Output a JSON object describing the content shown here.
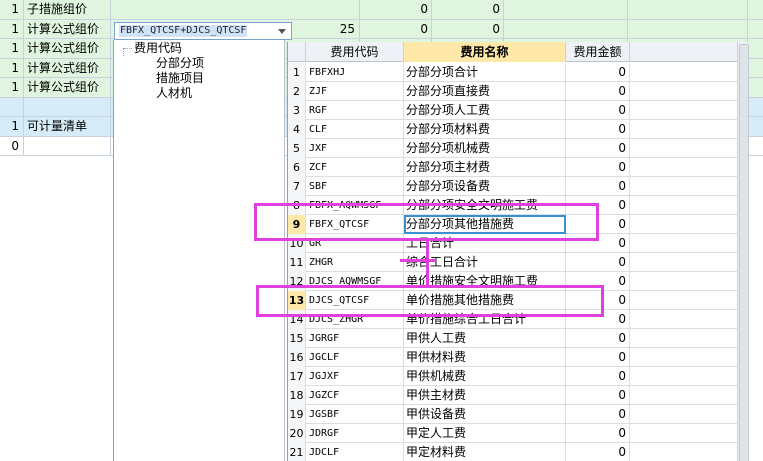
{
  "background_rows": [
    {
      "num": "1",
      "name": "子措施组价",
      "col3": "",
      "col4": "0",
      "col5": "0",
      "tone": "green"
    },
    {
      "num": "1",
      "name": "计算公式组价",
      "col3": "25",
      "col4": "0",
      "col5": "0",
      "tone": "green"
    },
    {
      "num": "1",
      "name": "计算公式组价",
      "col3": "",
      "col4": "",
      "col5": "",
      "tone": "green"
    },
    {
      "num": "1",
      "name": "计算公式组价",
      "col3": "",
      "col4": "",
      "col5": "",
      "tone": "green"
    },
    {
      "num": "1",
      "name": "计算公式组价",
      "col3": "",
      "col4": "",
      "col5": "",
      "tone": "green"
    },
    {
      "num": "",
      "name": "",
      "col3": "",
      "col4": "",
      "col5": "",
      "tone": "blue"
    },
    {
      "num": "1",
      "name": "可计量清单",
      "col3": "",
      "col4": "",
      "col5": "",
      "tone": "blue"
    },
    {
      "num": "0",
      "name": "",
      "col3": "",
      "col4": "",
      "col5": "",
      "tone": "white"
    }
  ],
  "formula_editor": {
    "value": "FBFX_QTCSF+DJCS_QTCSF"
  },
  "tree": {
    "root": "费用代码",
    "children": [
      "分部分项",
      "措施项目",
      "人材机"
    ]
  },
  "grid": {
    "headers": {
      "code": "费用代码",
      "name": "费用名称",
      "amount": "费用金额"
    },
    "rows": [
      {
        "num": "1",
        "code": "FBFXHJ",
        "name": "分部分项合计",
        "amount": "0"
      },
      {
        "num": "2",
        "code": "ZJF",
        "name": "分部分项直接费",
        "amount": "0"
      },
      {
        "num": "3",
        "code": "RGF",
        "name": "分部分项人工费",
        "amount": "0"
      },
      {
        "num": "4",
        "code": "CLF",
        "name": "分部分项材料费",
        "amount": "0"
      },
      {
        "num": "5",
        "code": "JXF",
        "name": "分部分项机械费",
        "amount": "0"
      },
      {
        "num": "6",
        "code": "ZCF",
        "name": "分部分项主材费",
        "amount": "0"
      },
      {
        "num": "7",
        "code": "SBF",
        "name": "分部分项设备费",
        "amount": "0"
      },
      {
        "num": "8",
        "code": "FBFX_AQWMSGF",
        "name": "分部分项安全文明施工费",
        "amount": "0"
      },
      {
        "num": "9",
        "code": "FBFX_QTCSF",
        "name": "分部分项其他措施费",
        "amount": "0",
        "highlight": true
      },
      {
        "num": "10",
        "code": "GR",
        "name": "工日合计",
        "amount": "0"
      },
      {
        "num": "11",
        "code": "ZHGR",
        "name": "综合工日合计",
        "amount": "0"
      },
      {
        "num": "12",
        "code": "DJCS_AQWMSGF",
        "name": "单价措施安全文明施工费",
        "amount": "0"
      },
      {
        "num": "13",
        "code": "DJCS_QTCSF",
        "name": "单价措施其他措施费",
        "amount": "0",
        "highlight": true
      },
      {
        "num": "14",
        "code": "DJCS_ZHGR",
        "name": "单价措施综合工日合计",
        "amount": "0"
      },
      {
        "num": "15",
        "code": "JGRGF",
        "name": "甲供人工费",
        "amount": "0"
      },
      {
        "num": "16",
        "code": "JGCLF",
        "name": "甲供材料费",
        "amount": "0"
      },
      {
        "num": "17",
        "code": "JGJXF",
        "name": "甲供机械费",
        "amount": "0"
      },
      {
        "num": "18",
        "code": "JGZCF",
        "name": "甲供主材费",
        "amount": "0"
      },
      {
        "num": "19",
        "code": "JGSBF",
        "name": "甲供设备费",
        "amount": "0"
      },
      {
        "num": "20",
        "code": "JDRGF",
        "name": "甲定人工费",
        "amount": "0"
      },
      {
        "num": "21",
        "code": "JDCLF",
        "name": "甲定材料费",
        "amount": "0"
      }
    ]
  },
  "colors": {
    "annotation": "#e040e0",
    "header_highlight": "#ffe8a8",
    "row_green": "#dff5df",
    "row_blue": "#d6ecf8"
  }
}
